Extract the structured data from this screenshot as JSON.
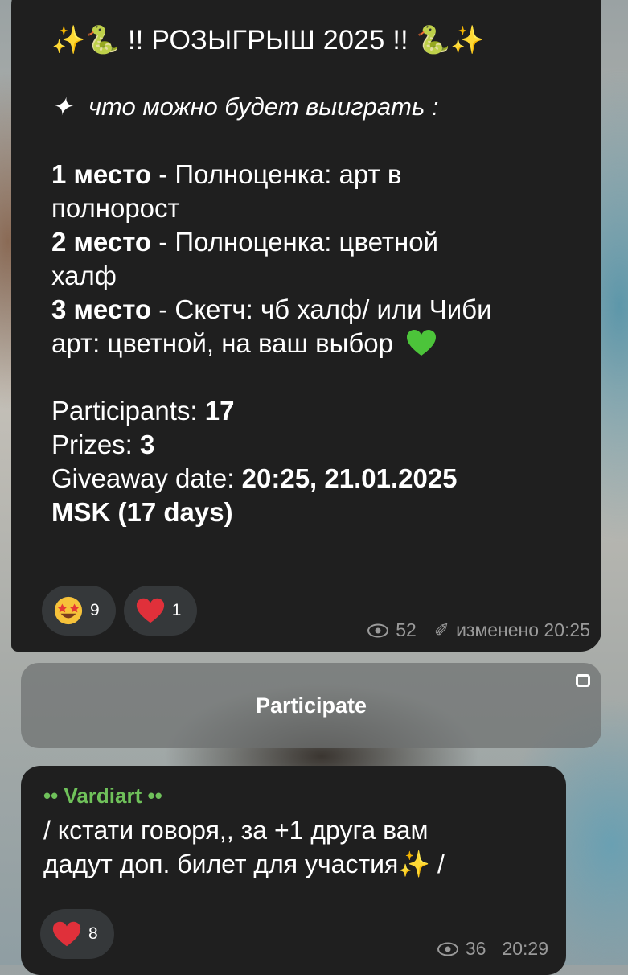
{
  "message1": {
    "title": "!! РОЗЫГРЫШ 2025 !!",
    "subtitle": "что можно будет выиграть :",
    "prize_lines": [
      {
        "place": "1 место",
        "text": " - Полноценка: арт в"
      },
      {
        "continuation": "полнорост"
      },
      {
        "place": "2 место",
        "text": " - Полноценка: цветной"
      },
      {
        "continuation": "халф"
      },
      {
        "place": "3 место",
        "text": " - Скетч: чб халф/ или Чиби"
      },
      {
        "continuation": "арт: цветной, на ваш выбор"
      }
    ],
    "participants_label": "Participants:",
    "participants_value": "17",
    "prizes_label": "Prizes:",
    "prizes_value": "3",
    "date_label": "Giveaway date:",
    "date_value": "20:25, 21.01.2025",
    "date_value_line2": "MSK (17 days)",
    "reactions": [
      {
        "icon": "star-struck-emoji",
        "count": "9"
      },
      {
        "icon": "red-heart-emoji",
        "count": "1"
      }
    ],
    "views": "52",
    "edited_label": "изменено 20:25"
  },
  "participate_button": "Participate",
  "message2": {
    "author": "•• Vardiart ••",
    "line1": "/ кстати говоря,, за +1 друга вам",
    "line2": "дадут доп. билет для участия",
    "line2_end": " /",
    "reactions": [
      {
        "icon": "red-heart-emoji",
        "count": "8"
      }
    ],
    "views": "36",
    "time": "20:29"
  },
  "colors": {
    "bubble": "#1f1f1f",
    "author": "#6fc15a",
    "meta": "#9a9a9a",
    "heart": "#e0303a",
    "green_heart": "#4cc43a"
  }
}
